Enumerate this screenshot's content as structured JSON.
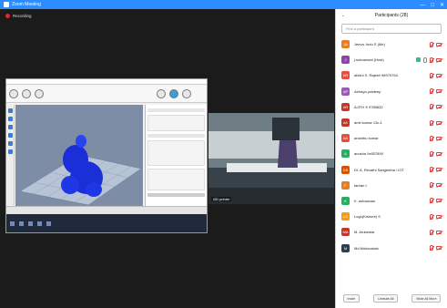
{
  "window": {
    "title": "Zoom Meeting",
    "min": "—",
    "max": "□",
    "close": "✕"
  },
  "recording": {
    "label": "Recording"
  },
  "video": {
    "label": "i3D printer",
    "accent": "#7f8f97"
  },
  "panel": {
    "title": "Participants (28)",
    "search_placeholder": "Find a participant",
    "participants": [
      {
        "initials": "JA",
        "name": "Jeeva. Indu S (Me)",
        "color": "#e67e22",
        "share": false
      },
      {
        "initials": "J",
        "name": "j.subramani (Host)",
        "color": "#8e44ad",
        "share": true
      },
      {
        "initials": "AR",
        "name": "abishi S. Rajesh 98979754",
        "color": "#e74c3c",
        "share": false
      },
      {
        "initials": "AP",
        "name": "Abhaya pradeep",
        "color": "#9b59b6",
        "share": false
      },
      {
        "initials": "AR",
        "name": "AJITH S 9789832",
        "color": "#c0392b",
        "share": false
      },
      {
        "initials": "AK",
        "name": "amit kumar 13c-1",
        "color": "#c0392b",
        "share": false
      },
      {
        "initials": "AK",
        "name": "ananthu kumar",
        "color": "#e74c3c",
        "share": false
      },
      {
        "initials": "A",
        "name": "anusha 9x657890",
        "color": "#27ae60",
        "share": false
      },
      {
        "initials": "DS",
        "name": "Dr. A. Revathi Sangeetha / IOT",
        "color": "#d35400",
        "share": false
      },
      {
        "initials": "F",
        "name": "farhan t",
        "color": "#e67e22",
        "share": false
      },
      {
        "initials": "K",
        "name": "K. ashwanan",
        "color": "#27ae60",
        "share": false
      },
      {
        "initials": "LS",
        "name": "Logu(Kishore) S",
        "color": "#f39c12",
        "share": false
      },
      {
        "initials": "MA",
        "name": "M. Arulanbar",
        "color": "#c0392b",
        "share": false
      },
      {
        "initials": "M",
        "name": "Md Moksvatain",
        "color": "#2c3e50",
        "share": false
      }
    ],
    "footer": {
      "invite": "Invite",
      "mute_all": "Unmute All",
      "more": "Mute All More"
    }
  }
}
